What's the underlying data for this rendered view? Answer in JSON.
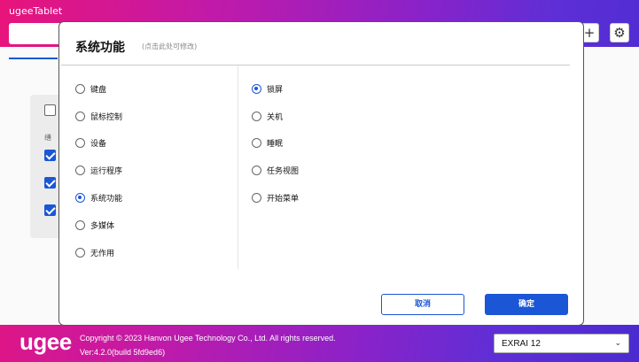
{
  "app": {
    "title": "ugeeTablet"
  },
  "toolbar": {
    "add_label": "+",
    "settings_icon": "gear-icon"
  },
  "background": {
    "column_char": "缮"
  },
  "modal": {
    "title": "系统功能",
    "subtitle": "(点击此处可修改)",
    "left_options": [
      {
        "label": "键盘",
        "selected": false
      },
      {
        "label": "鼠标控制",
        "selected": false
      },
      {
        "label": "设备",
        "selected": false
      },
      {
        "label": "运行程序",
        "selected": false
      },
      {
        "label": "系统功能",
        "selected": true
      },
      {
        "label": "多媒体",
        "selected": false
      },
      {
        "label": "无作用",
        "selected": false
      }
    ],
    "right_options": [
      {
        "label": "锁屏",
        "selected": true
      },
      {
        "label": "关机",
        "selected": false
      },
      {
        "label": "睡眠",
        "selected": false
      },
      {
        "label": "任务视图",
        "selected": false
      },
      {
        "label": "开始菜单",
        "selected": false
      }
    ],
    "cancel_label": "取消",
    "ok_label": "确定"
  },
  "footer": {
    "logo": "ugee",
    "copyright": "Copyright © 2023 Hanvon Ugee Technology Co., Ltd. All rights reserved.",
    "version": "Ver:4.2.0(build 5fd9ed6)",
    "device_selected": "EXRAI 12"
  },
  "colors": {
    "accent": "#1a56d6"
  }
}
